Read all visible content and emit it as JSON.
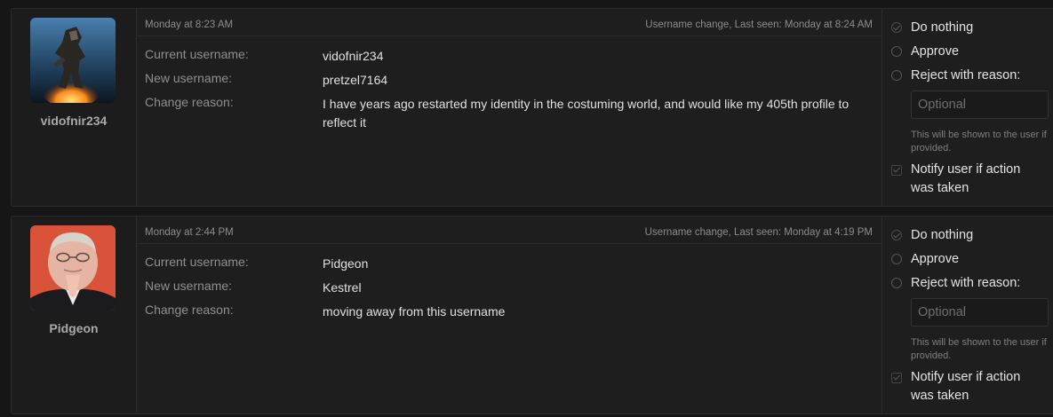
{
  "requests": [
    {
      "username": "vidofnir234",
      "date": "Monday at 8:23 AM",
      "last_seen": "Username change, Last seen: Monday at 8:24 AM",
      "labels": {
        "current": "Current username:",
        "new": "New username:",
        "reason": "Change reason:"
      },
      "current_username": "vidofnir234",
      "new_username": "pretzel7164",
      "change_reason": "I have years ago restarted my identity in the costuming world, and would like my 405th profile to reflect it",
      "actions": {
        "do_nothing": "Do nothing",
        "approve": "Approve",
        "reject": "Reject with reason:",
        "reason_placeholder": "Optional",
        "hint": "This will be shown to the user if provided.",
        "notify": "Notify user if action was taken"
      }
    },
    {
      "username": "Pidgeon",
      "date": "Monday at 2:44 PM",
      "last_seen": "Username change, Last seen: Monday at 4:19 PM",
      "labels": {
        "current": "Current username:",
        "new": "New username:",
        "reason": "Change reason:"
      },
      "current_username": "Pidgeon",
      "new_username": "Kestrel",
      "change_reason": "moving away from this username",
      "actions": {
        "do_nothing": "Do nothing",
        "approve": "Approve",
        "reject": "Reject with reason:",
        "reason_placeholder": "Optional",
        "hint": "This will be shown to the user if provided.",
        "notify": "Notify user if action was taken"
      }
    }
  ]
}
